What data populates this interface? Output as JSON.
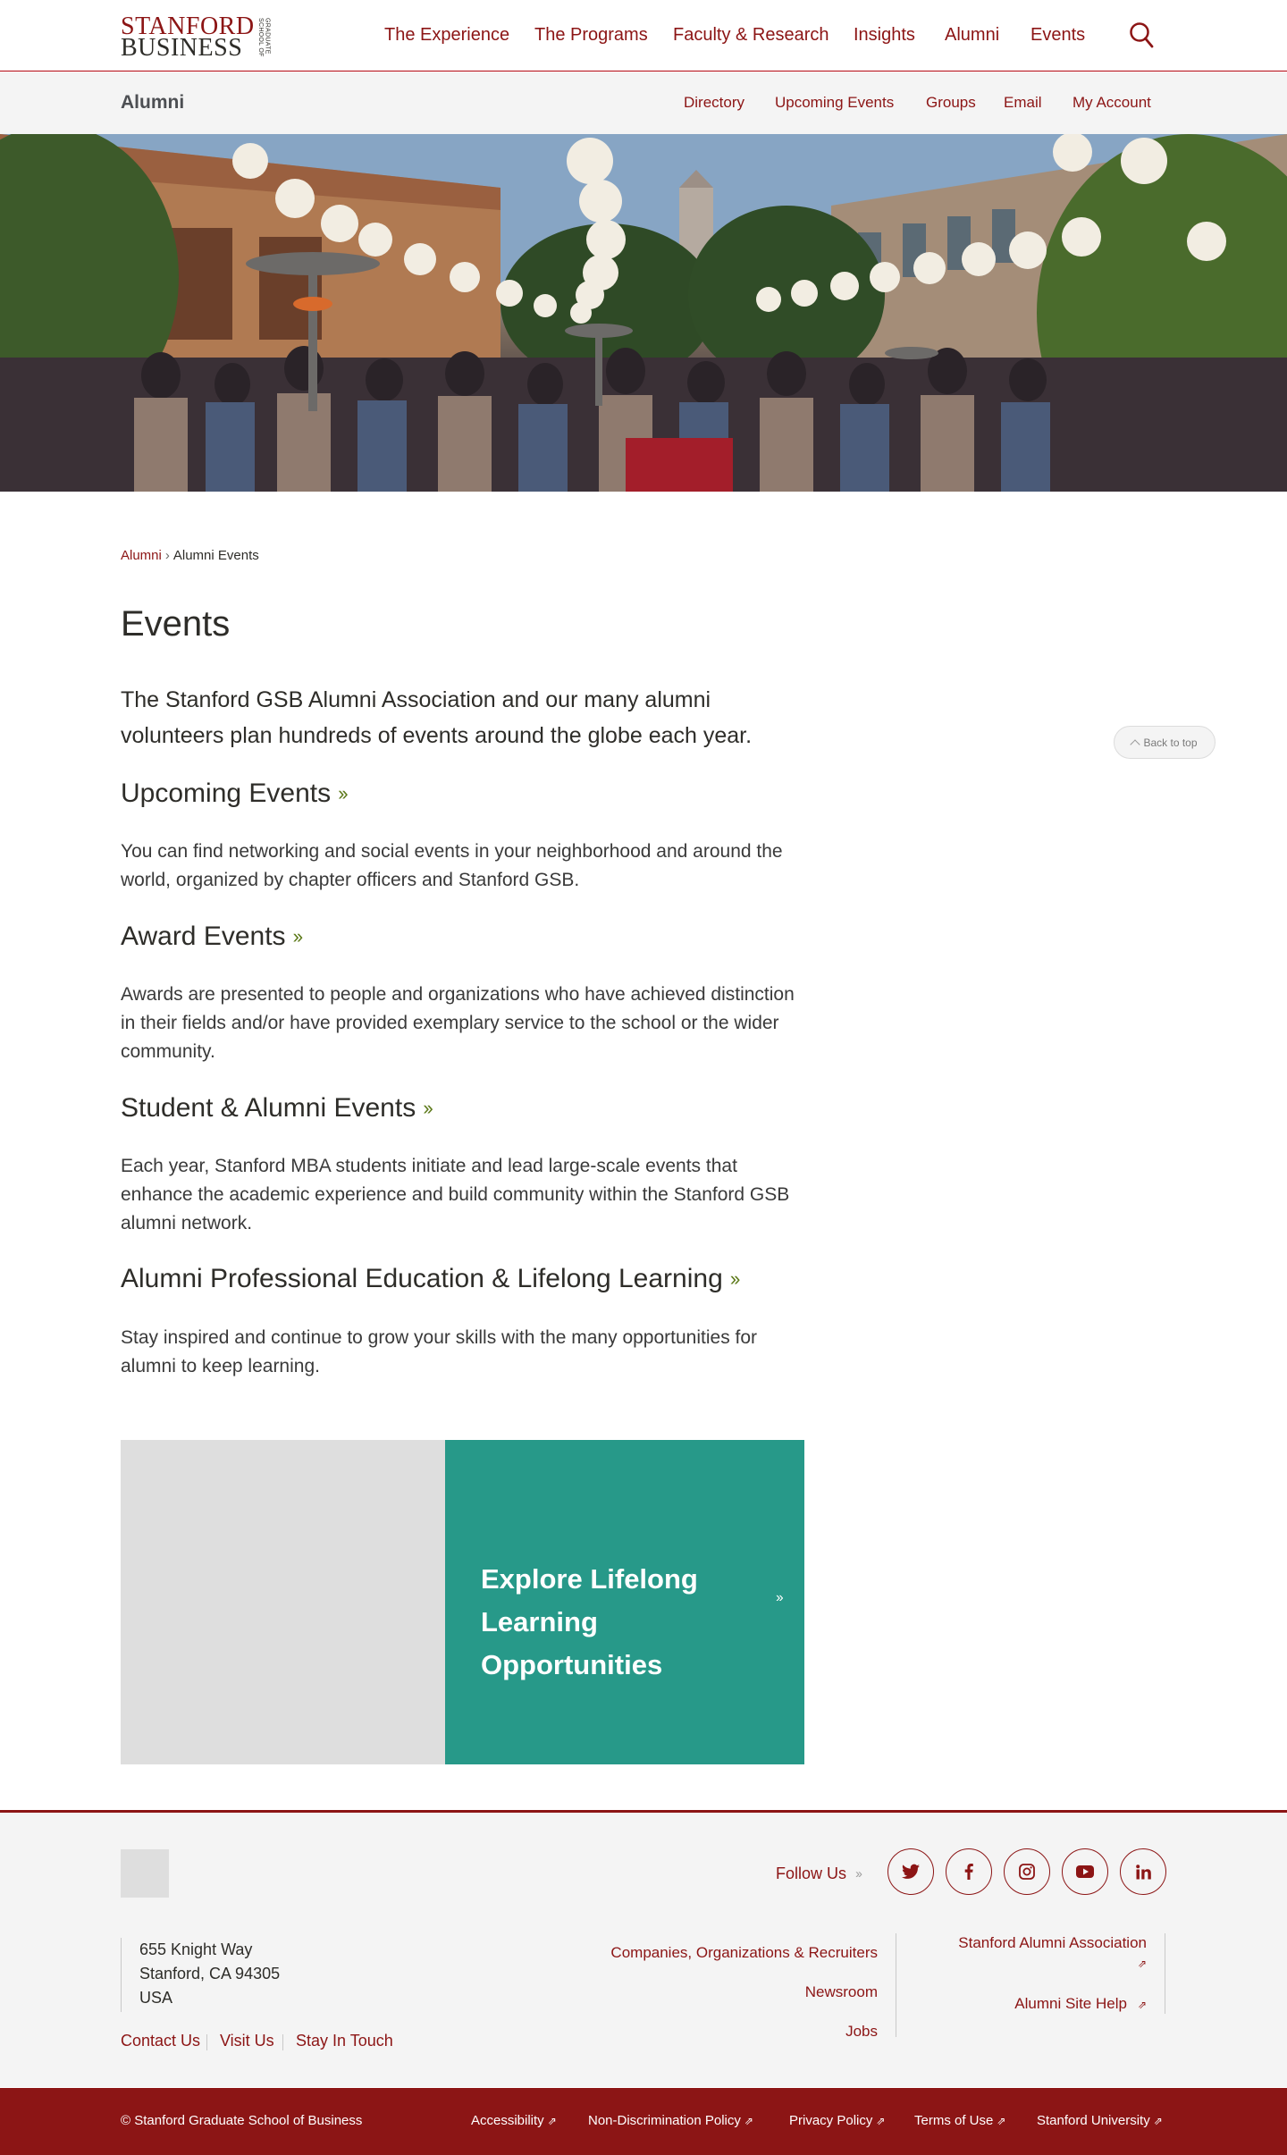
{
  "header": {
    "logo": {
      "line1": "STANFORD",
      "line2": "BUSINESS",
      "side": "GRADUATE SCHOOL OF"
    },
    "nav": [
      "The Experience",
      "The Programs",
      "Faculty & Research",
      "Insights",
      "Alumni",
      "Events"
    ],
    "search_icon": "search-icon"
  },
  "subheader": {
    "title": "Alumni",
    "nav": [
      "Directory",
      "Upcoming Events",
      "Groups",
      "Email",
      "My Account"
    ]
  },
  "breadcrumb": {
    "parent": "Alumni",
    "separator": "›",
    "current": "Alumni Events"
  },
  "page": {
    "title": "Events",
    "intro": "The Stanford GSB Alumni Association and our many alumni volunteers plan hundreds of events around the globe each year.",
    "sections": [
      {
        "heading": "Upcoming Events",
        "text": "You can find networking and social events in your neighborhood and around the world, organized by chapter officers and Stanford GSB."
      },
      {
        "heading": "Award Events",
        "text": "Awards are presented to people and organizations who have achieved distinction in their fields and/or have provided exemplary service to the school or the wider community."
      },
      {
        "heading": "Student & Alumni Events",
        "text": "Each year, Stanford MBA students initiate and lead large-scale events that enhance the academic experience and build community within the Stanford GSB alumni network."
      },
      {
        "heading": "Alumni Professional Education & Lifelong Learning",
        "text": "Stay inspired and continue to grow your skills with the many opportunities for alumni to keep learning."
      }
    ],
    "back_to_top": "Back to top",
    "promo": {
      "text": "Explore Lifelong Learning Opportunities"
    }
  },
  "footer": {
    "follow_label": "Follow Us",
    "social": [
      "twitter-icon",
      "facebook-icon",
      "instagram-icon",
      "youtube-icon",
      "linkedin-icon"
    ],
    "address": [
      "655 Knight Way",
      "Stanford, CA 94305",
      "USA"
    ],
    "bottom_links": [
      "Contact Us",
      "Visit Us",
      "Stay In Touch"
    ],
    "mid_links": [
      "Companies, Organizations & Recruiters",
      "Newsroom",
      "Jobs"
    ],
    "right_links": [
      "Stanford Alumni Association",
      "Alumni Site Help"
    ]
  },
  "bottom_bar": {
    "copyright": "© Stanford Graduate School of Business",
    "links": [
      "Accessibility",
      "Non-Discrimination Policy",
      "Privacy Policy",
      "Terms of Use",
      "Stanford University"
    ]
  },
  "colors": {
    "brand": "#8c1515",
    "accent_green": "#279989",
    "chevron": "#5d7a1a"
  }
}
